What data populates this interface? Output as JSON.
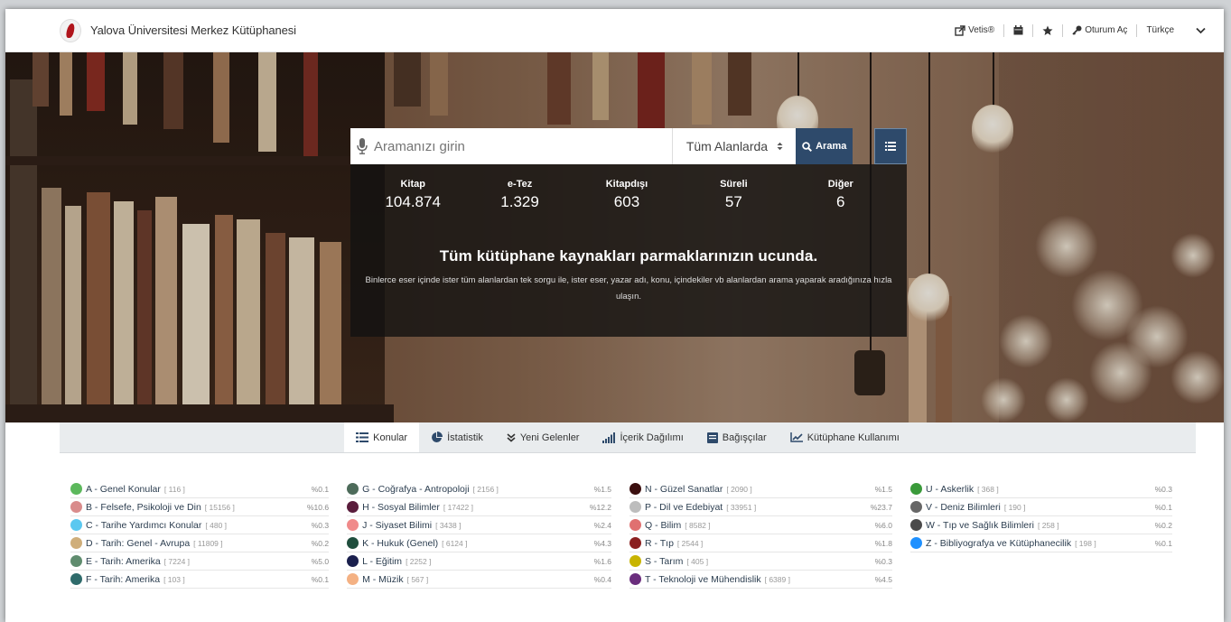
{
  "header": {
    "title": "Yalova Üniversitesi Merkez Kütüphanesi",
    "vetis": "Vetis®",
    "login": "Oturum Aç",
    "language": "Türkçe"
  },
  "search": {
    "placeholder": "Aramanızı girin",
    "scope": "Tüm Alanlarda",
    "button": "Arama"
  },
  "stats": [
    {
      "label": "Kitap",
      "value": "104.874"
    },
    {
      "label": "e-Tez",
      "value": "1.329"
    },
    {
      "label": "Kitapdışı",
      "value": "603"
    },
    {
      "label": "Süreli",
      "value": "57"
    },
    {
      "label": "Diğer",
      "value": "6"
    }
  ],
  "tagline": "Tüm kütüphane kaynakları parmaklarınızın ucunda.",
  "description": "Binlerce eser içinde ister tüm alanlardan tek sorgu ile, ister eser, yazar adı, konu, içindekiler vb alanlardan arama yaparak aradığınıza hızla ulaşın.",
  "tabs": [
    {
      "label": "Konular",
      "icon": "list-icon"
    },
    {
      "label": "İstatistik",
      "icon": "pie-chart-icon"
    },
    {
      "label": "Yeni Gelenler",
      "icon": "chevrons-down-icon"
    },
    {
      "label": "İçerik Dağılımı",
      "icon": "signal-icon"
    },
    {
      "label": "Bağışçılar",
      "icon": "book-icon"
    },
    {
      "label": "Kütüphane Kullanımı",
      "icon": "line-chart-icon"
    }
  ],
  "topics": [
    [
      {
        "name": "A - Genel Konular",
        "count": "[ 116 ]",
        "pct": "%0.1",
        "color": "#5cb85c"
      },
      {
        "name": "B - Felsefe, Psikoloji ve Din",
        "count": "[ 15156 ]",
        "pct": "%10.6",
        "color": "#d98c8c"
      },
      {
        "name": "C - Tarihe Yardımcı Konular",
        "count": "[ 480 ]",
        "pct": "%0.3",
        "color": "#5bc8f0"
      },
      {
        "name": "D - Tarih: Genel - Avrupa",
        "count": "[ 11809 ]",
        "pct": "%0.2",
        "color": "#cfae7a"
      },
      {
        "name": "E - Tarih: Amerika",
        "count": "[ 7224 ]",
        "pct": "%5.0",
        "color": "#5f8c6e"
      },
      {
        "name": "F - Tarih: Amerika",
        "count": "[ 103 ]",
        "pct": "%0.1",
        "color": "#2f6b6b"
      }
    ],
    [
      {
        "name": "G - Coğrafya - Antropoloji",
        "count": "[ 2156 ]",
        "pct": "%1.5",
        "color": "#4d6b5a"
      },
      {
        "name": "H - Sosyal Bilimler",
        "count": "[ 17422 ]",
        "pct": "%12.2",
        "color": "#5a1d3c"
      },
      {
        "name": "J - Siyaset Bilimi",
        "count": "[ 3438 ]",
        "pct": "%2.4",
        "color": "#f08a8a"
      },
      {
        "name": "K - Hukuk (Genel)",
        "count": "[ 6124 ]",
        "pct": "%4.3",
        "color": "#1f4e3d"
      },
      {
        "name": "L - Eğitim",
        "count": "[ 2252 ]",
        "pct": "%1.6",
        "color": "#1a1f4d"
      },
      {
        "name": "M - Müzik",
        "count": "[ 567 ]",
        "pct": "%0.4",
        "color": "#f4b183"
      }
    ],
    [
      {
        "name": "N - Güzel Sanatlar",
        "count": "[ 2090 ]",
        "pct": "%1.5",
        "color": "#3b0f0f"
      },
      {
        "name": "P - Dil ve Edebiyat",
        "count": "[ 33951 ]",
        "pct": "%23.7",
        "color": "#bdbdbd"
      },
      {
        "name": "Q - Bilim",
        "count": "[ 8582 ]",
        "pct": "%6.0",
        "color": "#e07070"
      },
      {
        "name": "R - Tıp",
        "count": "[ 2544 ]",
        "pct": "%1.8",
        "color": "#8b2020"
      },
      {
        "name": "S - Tarım",
        "count": "[ 405 ]",
        "pct": "%0.3",
        "color": "#c8b400"
      },
      {
        "name": "T - Teknoloji ve Mühendislik",
        "count": "[ 6389 ]",
        "pct": "%4.5",
        "color": "#6a2d7d"
      }
    ],
    [
      {
        "name": "U - Askerlik",
        "count": "[ 368 ]",
        "pct": "%0.3",
        "color": "#3a9a3a"
      },
      {
        "name": "V - Deniz Bilimleri",
        "count": "[ 190 ]",
        "pct": "%0.1",
        "color": "#666666"
      },
      {
        "name": "W - Tıp ve Sağlık Bilimleri",
        "count": "[ 258 ]",
        "pct": "%0.2",
        "color": "#4a4a4a"
      },
      {
        "name": "Z - Bibliyografya ve Kütüphanecilik",
        "count": "[ 198 ]",
        "pct": "%0.1",
        "color": "#1e90ff"
      }
    ]
  ],
  "colors": {
    "accent": "#2e4a6b",
    "panel": "#141211"
  }
}
